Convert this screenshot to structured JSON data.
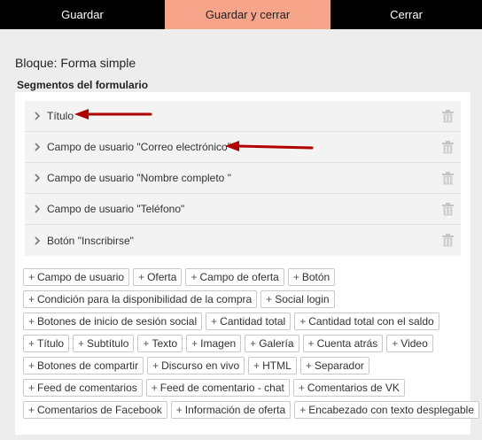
{
  "toolbar": {
    "save_label": "Guardar",
    "save_close_label": "Guardar y cerrar",
    "close_label": "Cerrar"
  },
  "colors": {
    "accent": "#f6a58a",
    "toolbar_bg": "#000000",
    "arrow": "#b00000"
  },
  "block_title": "Bloque: Forma simple",
  "section_title": "Segmentos del formulario",
  "segments": [
    {
      "label": "Título",
      "icon": "chevron-right-icon"
    },
    {
      "label": "Campo de usuario \"Correo electrónico\"",
      "icon": "chevron-right-icon"
    },
    {
      "label": "Campo de usuario \"Nombre completo \"",
      "icon": "chevron-right-icon"
    },
    {
      "label": "Campo de usuario \"Teléfono\"",
      "icon": "chevron-right-icon"
    },
    {
      "label": "Botón \"Inscribirse\"",
      "icon": "chevron-right-icon"
    }
  ],
  "add_buttons": [
    [
      "Campo de usuario",
      "Oferta",
      "Campo de oferta",
      "Botón"
    ],
    [
      "Condición para la disponibilidad de la compra",
      "Social login"
    ],
    [
      "Botones de inicio de sesión social",
      "Cantidad total",
      "Cantidad total con el saldo"
    ],
    [
      "Título",
      "Subtítulo",
      "Texto",
      "Imagen",
      "Galería",
      "Cuenta atrás",
      "Video"
    ],
    [
      "Botones de compartir",
      "Discurso en vivo",
      "HTML",
      "Separador"
    ],
    [
      "Feed de comentarios",
      "Feed de comentario - chat",
      "Comentarios de VK"
    ],
    [
      "Comentarios de Facebook",
      "Información de oferta",
      "Encabezado con texto desplegable"
    ]
  ],
  "plus_symbol": "+"
}
